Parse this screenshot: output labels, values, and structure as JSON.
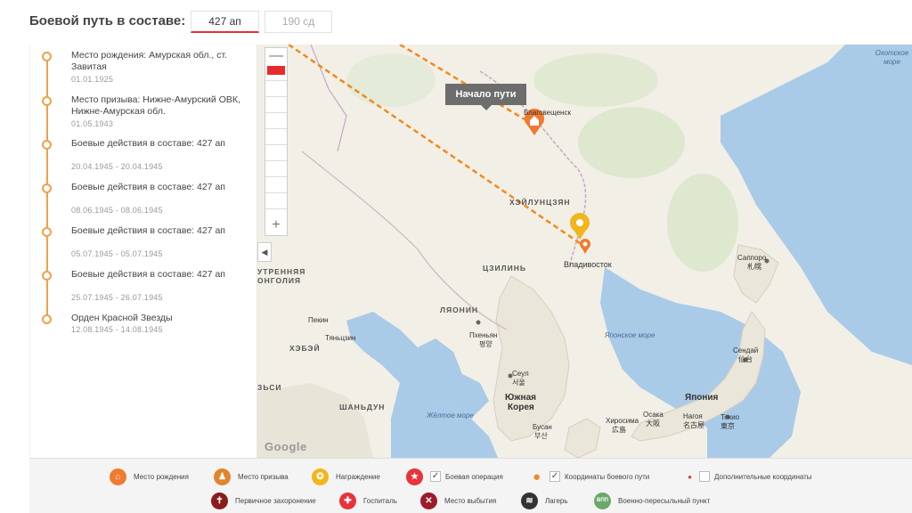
{
  "header": {
    "title": "Боевой путь в составе:",
    "tabs": [
      {
        "label": "427 ап",
        "active": true
      },
      {
        "label": "190 сд",
        "active": false
      }
    ]
  },
  "timeline": {
    "accent_color": "#f0a04b",
    "items": [
      {
        "text": "Место рождения: Амурская обл., ст. Завитая",
        "date": "01.01.1925"
      },
      {
        "text": "Место призыва: Нижне-Амурский ОВК, Нижне-Амурская обл.",
        "date": "01.05.1943"
      },
      {
        "text": "Боевые действия в составе: 427 ап",
        "date": "20.04.1945 - 20.04.1945"
      },
      {
        "text": "Боевые действия в составе: 427 ап",
        "date": "08.06.1945 - 08.06.1945"
      },
      {
        "text": "Боевые действия в составе: 427 ап",
        "date": "05.07.1945 - 05.07.1945"
      },
      {
        "text": "Боевые действия в составе: 427 ап",
        "date": "25.07.1945 - 26.07.1945"
      },
      {
        "text": "Орден Красной Звезды",
        "date": "12.08.1945 - 14.08.1945"
      }
    ]
  },
  "map": {
    "zoom_in": "+",
    "zoom_out": "—",
    "collapse": "◀",
    "tooltip": "Начало пути",
    "google": "Google",
    "labels": {
      "okhotsk": "Охотское море",
      "blagoveshchensk": "Благовещенск",
      "heilongjiang": "ХЭЙЛУНЦЗЯН",
      "jilin": "ЦЗИЛИНЬ",
      "vladivostok": "Владивосток",
      "inner_mongolia_1": "УТРЕННЯЯ",
      "inner_mongolia_2": "ОНГОЛИЯ",
      "liaoning": "ЛЯОНИН",
      "beijing": "Пекин",
      "tianjin": "Тяньцзин",
      "hebei": "ХЭБЭЙ",
      "shanxi": "ЗЬСИ",
      "pyongyang": "Пхеньян",
      "pyongyang_kr": "평양",
      "seoul": "Сеул",
      "seoul_kr": "서울",
      "south_korea_1": "Южная",
      "south_korea_2": "Корея",
      "shandong": "ШАНЬДУН",
      "yellow_sea": "Жёлтое море",
      "japan_sea": "Японское море",
      "busan": "Бусан",
      "busan_kr": "부산",
      "sapporo": "Саппоро",
      "sapporo_jp": "札幌",
      "sendai": "Сендай",
      "sendai_jp": "仙台",
      "japan": "Япония",
      "hiroshima": "Хиросима",
      "hiroshima_jp": "広島",
      "osaka": "Осака",
      "osaka_jp": "大阪",
      "nagoya": "Нагоя",
      "nagoya_jp": "名古屋",
      "tokyo": "Токио",
      "tokyo_jp": "東京"
    }
  },
  "legend": {
    "items": [
      {
        "label": "Место рождения",
        "icon": "home-icon",
        "color": "#f07a2e"
      },
      {
        "label": "Место призыва",
        "icon": "person-icon",
        "color": "#e0852e"
      },
      {
        "label": "Награждение",
        "icon": "medal-icon",
        "color": "#f2b51c"
      },
      {
        "label": "Боевая операция",
        "icon": "star-icon",
        "color": "#e8333a",
        "checked": true
      },
      {
        "label": "Координаты боевого пути",
        "icon": "pin-icon",
        "color": "#f08a2e",
        "checked": true
      },
      {
        "label": "Дополнительные координаты",
        "icon": "dot-icon",
        "color": "#e8333a",
        "checked": false
      },
      {
        "label": "Первичное захоронение",
        "icon": "cross-icon",
        "color": "#8b1c1c"
      },
      {
        "label": "Госпиталь",
        "icon": "hospital-icon",
        "color": "#e8333a"
      },
      {
        "label": "Место выбытия",
        "icon": "x-icon",
        "color": "#9c1c2a"
      },
      {
        "label": "Лагерь",
        "icon": "camp-icon",
        "color": "#333333"
      },
      {
        "label": "Военно-пересыльный пункт",
        "icon": "vpp-icon",
        "color": "#6aa86a",
        "icon_text": "ВПП"
      }
    ]
  }
}
